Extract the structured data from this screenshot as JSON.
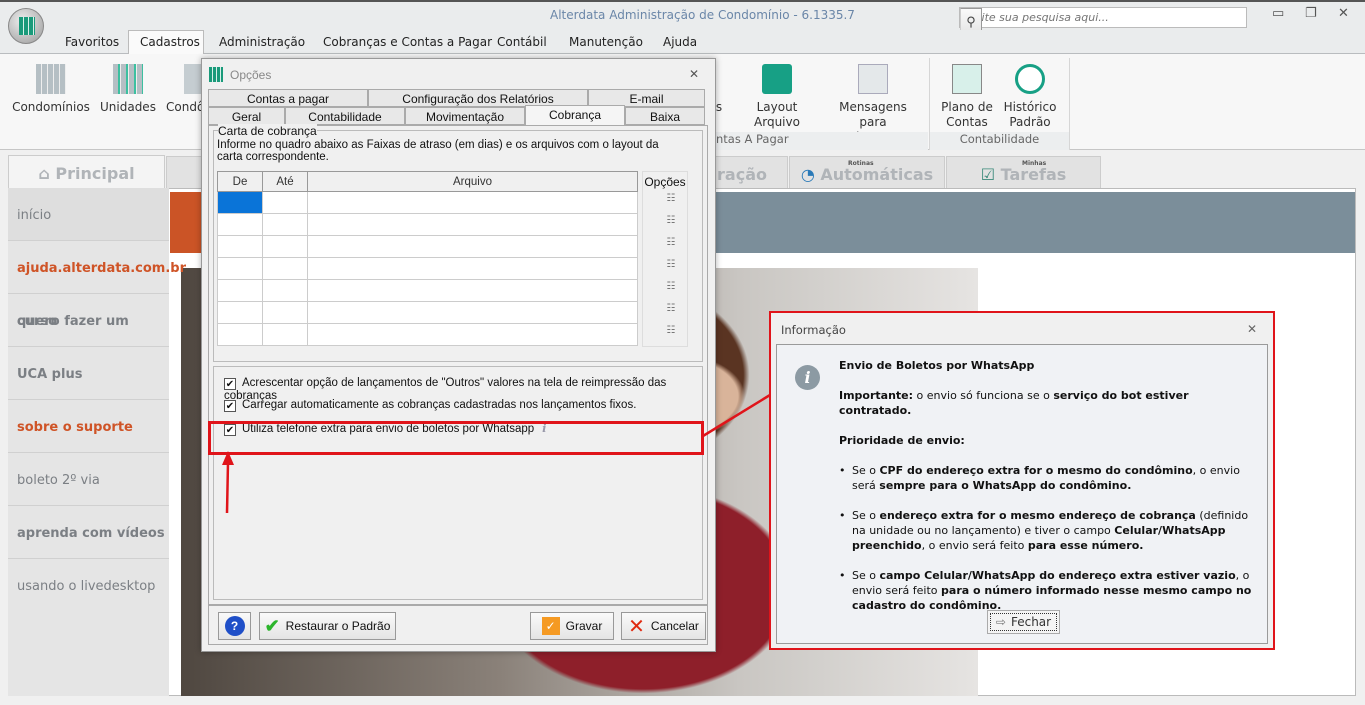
{
  "app": {
    "title": "Alterdata Administração de Condomínio - 6.1335.7",
    "search_placeholder": "Digite sua pesquisa aqui..."
  },
  "menu": [
    "Favoritos",
    "Cadastros",
    "Administração",
    "Cobranças e Contas a Pagar",
    "Contábil",
    "Manutenção",
    "Ajuda"
  ],
  "ribbon": {
    "items": [
      "Condomínios",
      "Unidades",
      "Condô",
      "Layout Arquivo Remessa",
      "Mensagens para cobranças",
      "Plano de Contas",
      "Histórico Padrão",
      "s"
    ],
    "groups": [
      "ntas A Pagar",
      "Contabilidade"
    ]
  },
  "main_tabs": {
    "principal": "Principal",
    "integracao": "gração",
    "rotinas_small": "Rotinas",
    "rotinas": "Automáticas",
    "tarefas_small": "Minhas",
    "tarefas": "Tarefas"
  },
  "sidebar": [
    "início",
    "ajuda.alterdata.com.br",
    "quero fazer um curso",
    "UCA plus",
    "sobre o suporte",
    "boleto 2º via",
    "aprenda com vídeos",
    "usando o livedesktop"
  ],
  "options": {
    "title": "Opções",
    "tabs_row1": [
      "Contas a pagar",
      "Configuração dos Relatórios",
      "E-mail"
    ],
    "tabs_row2": [
      "Geral",
      "Contabilidade",
      "Movimentação",
      "Cobrança",
      "Baixa"
    ],
    "group_title": "Carta de cobrança",
    "description": "Informe no quadro abaixo as Faixas de atraso (em dias) e os arquivos com o layout  da carta correspondente.",
    "columns": [
      "De",
      "Até",
      "Arquivo"
    ],
    "options_col": "Opções",
    "checkboxes": [
      {
        "label": "Acrescentar opção de lançamentos de \"Outros\" valores na tela de reimpressão das cobranças",
        "checked": true
      },
      {
        "label": "Carregar automaticamente as cobranças cadastradas nos lançamentos fixos.",
        "checked": true
      },
      {
        "label": "Utiliza telefone extra para envio de boletos por Whatsapp",
        "checked": true
      }
    ],
    "buttons": {
      "restore": "Restaurar o Padrão",
      "save": "Gravar",
      "cancel": "Cancelar"
    }
  },
  "info": {
    "title": "Informação",
    "heading": "Envio de Boletos por WhatsApp",
    "important_b": "Importante:",
    "important_t": " o envio só funciona se o ",
    "important_b2": "serviço do bot estiver contratado.",
    "priority": "Prioridade de envio:",
    "b1": [
      "Se o ",
      "CPF do endereço extra for o mesmo do condômino",
      ", o envio será ",
      "sempre para o WhatsApp do condômino."
    ],
    "b2": [
      "Se o ",
      "endereço extra for o mesmo endereço de cobrança",
      " (definido na unidade ou no lançamento) e tiver o campo ",
      "Celular/WhatsApp preenchido",
      ", o envio será feito ",
      "para esse número."
    ],
    "b3": [
      "Se o ",
      "campo Celular/WhatsApp do endereço extra estiver vazio",
      ", o envio será feito ",
      "para o número informado nesse mesmo campo no cadastro do condômino."
    ],
    "close": "Fechar"
  }
}
